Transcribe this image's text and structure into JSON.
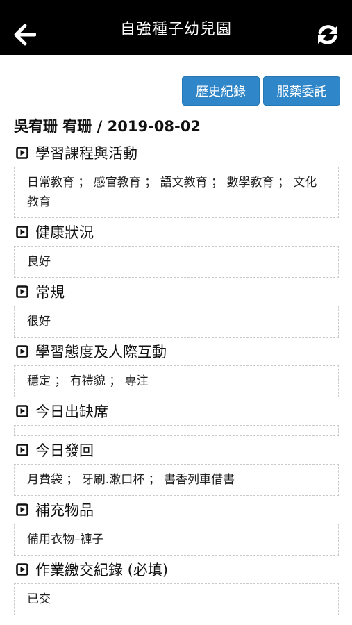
{
  "header": {
    "title": "自強種子幼兒園",
    "back_icon": "arrow-left-icon",
    "refresh_icon": "refresh-icon"
  },
  "toolbar": {
    "history_label": "歷史紀錄",
    "medication_label": "服藥委託"
  },
  "student": {
    "line": "吳宥珊 宥珊 / 2019-08-02"
  },
  "colors": {
    "topbar": "#000000",
    "button": "#2f86c8"
  },
  "sections": [
    {
      "title": "學習課程與活動",
      "content": "日常教育 ； 感官教育 ； 語文教育 ； 數學教育 ； 文化教育"
    },
    {
      "title": "健康狀況",
      "content": "良好"
    },
    {
      "title": "常規",
      "content": "很好"
    },
    {
      "title": "學習態度及人際互動",
      "content": "穩定 ； 有禮貌 ； 專注"
    },
    {
      "title": "今日出缺席",
      "content": ""
    },
    {
      "title": "今日發回",
      "content": "月費袋 ； 牙刷.漱口杯 ； 書香列車借書"
    },
    {
      "title": "補充物品",
      "content": "備用衣物–褲子"
    },
    {
      "title": "作業繳交紀錄 (必填)",
      "content": "已交"
    }
  ]
}
